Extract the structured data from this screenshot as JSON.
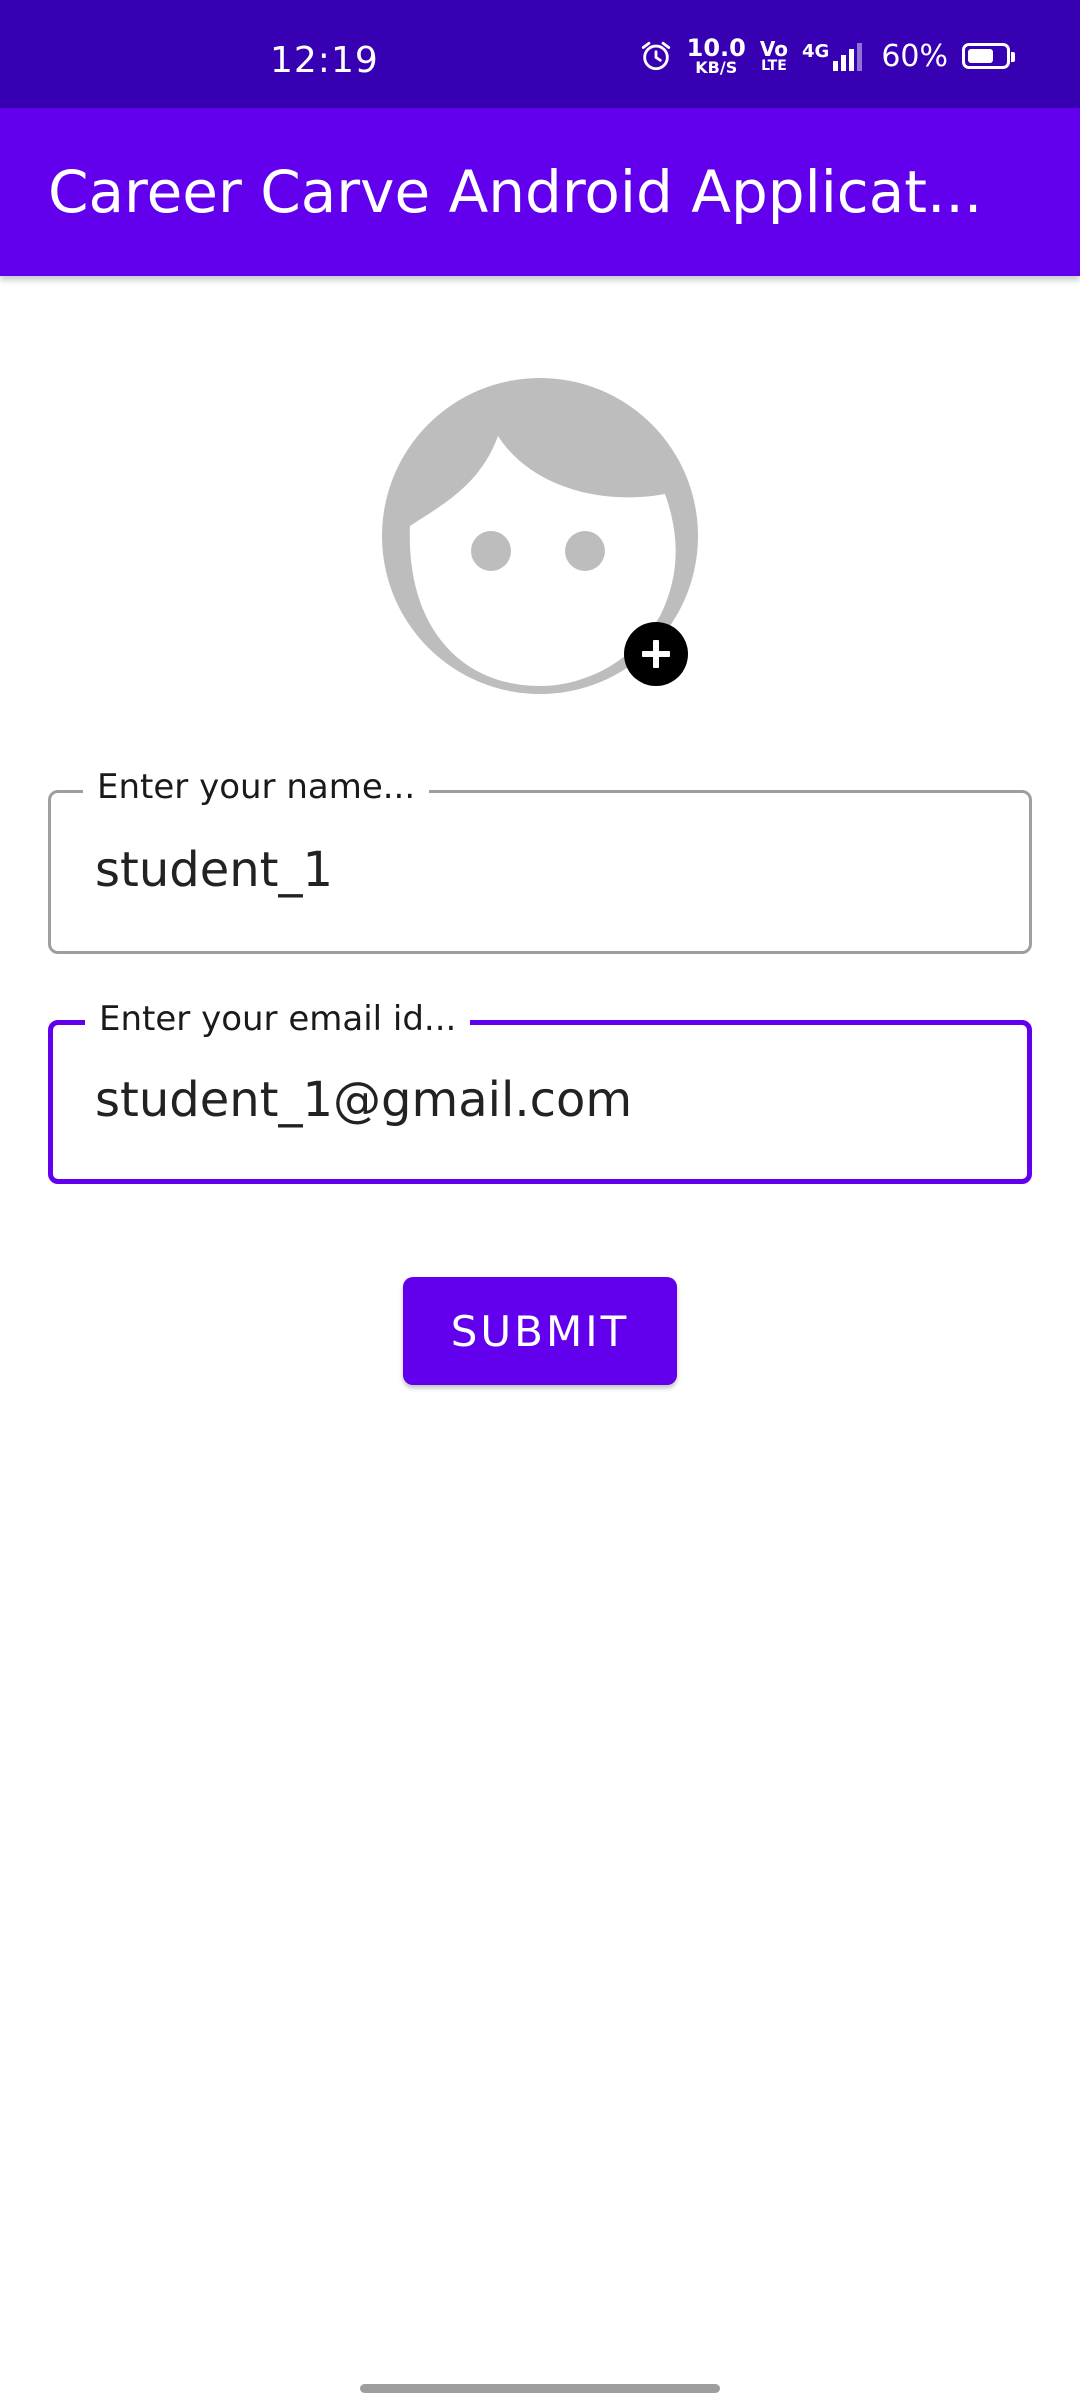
{
  "status_bar": {
    "time": "12:19",
    "net_speed_value": "10.0",
    "net_speed_unit": "KB/S",
    "volte_top": "Vo",
    "volte_bottom": "LTE",
    "network": "4G",
    "battery_percent": "60%",
    "battery_level": 0.6,
    "icons": [
      "alarm-icon",
      "signal-icon",
      "battery-icon"
    ]
  },
  "app_bar": {
    "title": "Career Carve Android Applicat..."
  },
  "profile": {
    "avatar_icon": "face-avatar-icon",
    "add_icon": "add-circle-icon"
  },
  "form": {
    "name_field": {
      "label": "Enter your name...",
      "value": "student_1"
    },
    "email_field": {
      "label": "Enter your email id...",
      "value": "student_1@gmail.com"
    },
    "submit_label": "SUBMIT"
  },
  "colors": {
    "primary": "#6200EE",
    "primary_dark": "#3700B3",
    "avatar_gray": "#BDBDBD",
    "outline_gray": "#9E9E9E"
  }
}
